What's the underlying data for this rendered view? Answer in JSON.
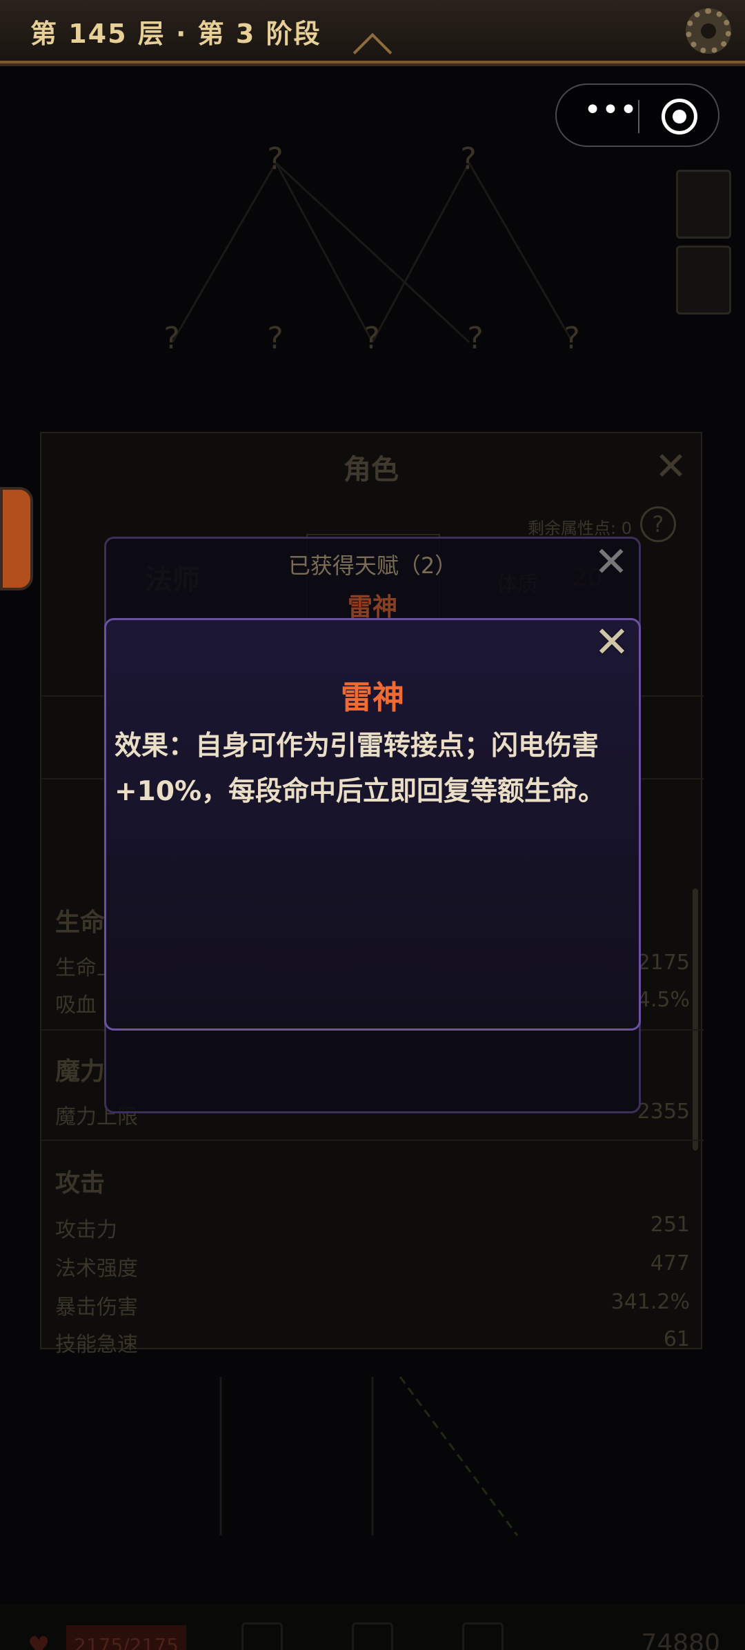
{
  "header": {
    "title": "第 145 层 · 第 3 阶段"
  },
  "capsule": {
    "more": "•••"
  },
  "map": {
    "unknown_node": "?"
  },
  "character_panel": {
    "title": "角色",
    "remaining_points": "剩余属性点: 0",
    "help": "?",
    "class_name": "法师",
    "attribute": {
      "label": "体质",
      "value": "20"
    },
    "sections": [
      {
        "title": "生命",
        "rows": [
          {
            "key": "生命上限",
            "value": "2175"
          },
          {
            "key": "吸血",
            "value": "4.5%"
          }
        ]
      },
      {
        "title": "魔力",
        "rows": [
          {
            "key": "魔力上限",
            "value": "2355"
          }
        ]
      },
      {
        "title": "攻击",
        "rows": [
          {
            "key": "攻击力",
            "value": "251"
          },
          {
            "key": "法术强度",
            "value": "477"
          },
          {
            "key": "暴击伤害",
            "value": "341.2%"
          },
          {
            "key": "技能急速",
            "value": "61"
          }
        ]
      }
    ]
  },
  "talents_modal": {
    "title": "已获得天赋（2）",
    "first_item": "雷神"
  },
  "talent_detail": {
    "name": "雷神",
    "description": "效果：自身可作为引雷转接点；闪电伤害+10%，每段命中后立即回复等额生命。"
  },
  "bottom_bar": {
    "hp": "2175/2175",
    "coins": "74880"
  },
  "colors": {
    "talent_name": "#f06b32",
    "modal_border": "#6a52a0",
    "header_text": "#e7cf98"
  }
}
